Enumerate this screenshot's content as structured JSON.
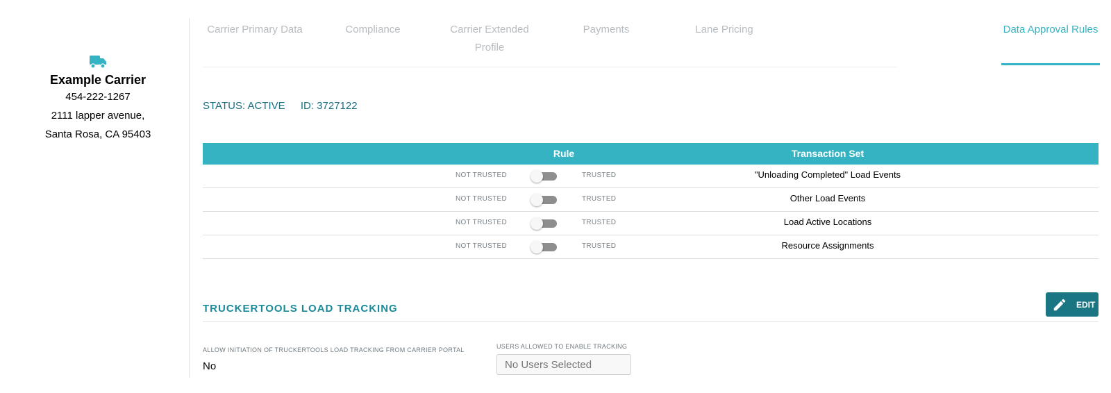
{
  "carrier": {
    "icon": "truck-icon",
    "name": "Example Carrier",
    "phone": "454-222-1267",
    "address_line1": "2111 lapper avenue,",
    "address_line2": "Santa Rosa, CA 95403"
  },
  "tabs": [
    {
      "label": "Carrier Primary Data",
      "active": false
    },
    {
      "label": "Compliance",
      "active": false
    },
    {
      "label": "Carrier Extended Profile",
      "active": false
    },
    {
      "label": "Payments",
      "active": false
    },
    {
      "label": "Lane Pricing",
      "active": false
    },
    {
      "label": "Data Approval Rules",
      "active": true
    }
  ],
  "status": {
    "status_text": "STATUS: ACTIVE",
    "id_text": "ID: 3727122"
  },
  "rules_table": {
    "headers": {
      "rule": "Rule",
      "transaction_set": "Transaction Set"
    },
    "rows": [
      {
        "not_trusted": "NOT TRUSTED",
        "trusted": "TRUSTED",
        "toggle_on": false,
        "transaction_set": "\"Unloading Completed\" Load Events"
      },
      {
        "not_trusted": "NOT TRUSTED",
        "trusted": "TRUSTED",
        "toggle_on": false,
        "transaction_set": "Other Load Events"
      },
      {
        "not_trusted": "NOT TRUSTED",
        "trusted": "TRUSTED",
        "toggle_on": false,
        "transaction_set": "Load Active Locations"
      },
      {
        "not_trusted": "NOT TRUSTED",
        "trusted": "TRUSTED",
        "toggle_on": false,
        "transaction_set": "Resource Assignments"
      }
    ]
  },
  "tracking": {
    "title": "TRUCKERTOOLS LOAD TRACKING",
    "edit_label": "EDIT",
    "edit_icon": "pencil-icon",
    "allow_label": "ALLOW INITIATION OF TRUCKERTOOLS LOAD TRACKING FROM CARRIER PORTAL",
    "allow_value": "No",
    "users_label": "USERS ALLOWED TO ENABLE TRACKING",
    "users_placeholder": "No Users Selected"
  },
  "colors": {
    "accent": "#36b3c3",
    "status_text": "#1a6f80",
    "edit_button": "#1b7684"
  }
}
